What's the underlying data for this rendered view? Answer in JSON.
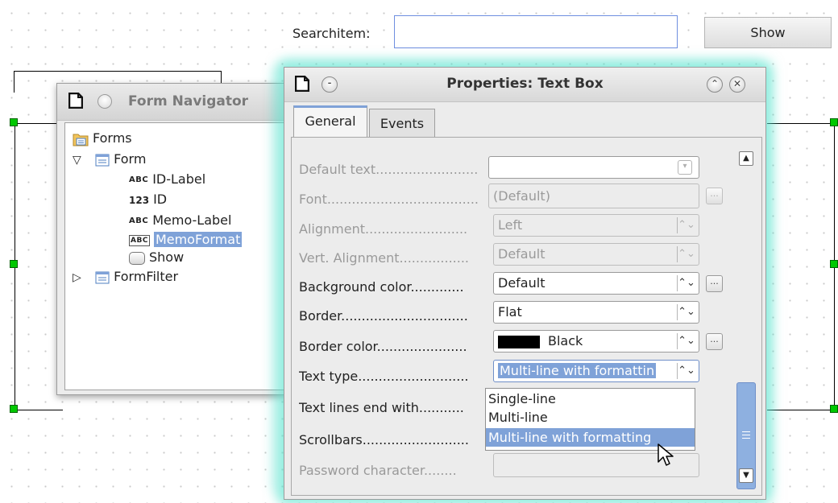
{
  "search": {
    "label": "Searchitem:",
    "value": ""
  },
  "show_button": {
    "label": "Show"
  },
  "navigator": {
    "title": "Form Navigator",
    "tree": [
      {
        "label": "Forms",
        "icon": "forms-folder-icon"
      },
      {
        "label": "Form",
        "icon": "form-icon",
        "expander": "▽"
      },
      {
        "label": "ID-Label",
        "badge": "ABC"
      },
      {
        "label": "ID",
        "badge": "123"
      },
      {
        "label": "Memo-Label",
        "badge": "ABC"
      },
      {
        "label": "MemoFormat",
        "badge": "ABC",
        "selected": true
      },
      {
        "label": "Show",
        "icon": "button-icon"
      },
      {
        "label": "FormFilter",
        "icon": "form-icon",
        "expander": "▷"
      }
    ]
  },
  "properties": {
    "title": "Properties: Text Box",
    "tabs": [
      "General",
      "Events"
    ],
    "rows": [
      {
        "label": "Default text.........................",
        "value": "",
        "disabled": true
      },
      {
        "label": "Font.....................................",
        "value": "(Default)",
        "disabled": true
      },
      {
        "label": "Alignment.........................",
        "value": "Left",
        "disabled": true
      },
      {
        "label": "Vert. Alignment.................",
        "value": "Default",
        "disabled": true
      },
      {
        "label": "Background color.............",
        "value": "Default",
        "disabled": false
      },
      {
        "label": "Border...............................",
        "value": "Flat",
        "disabled": false
      },
      {
        "label": "Border color......................",
        "value": "Black",
        "disabled": false
      },
      {
        "label": "Text type...........................",
        "value": "Multi-line with formattin",
        "disabled": false
      },
      {
        "label": "Text lines end with...........",
        "value": "",
        "disabled": false
      },
      {
        "label": "Scrollbars..........................",
        "value": "",
        "disabled": false
      },
      {
        "label": "Password character........",
        "value": "",
        "disabled": true
      }
    ],
    "dropdown_options": [
      "Single-line",
      "Multi-line",
      "Multi-line with formatting"
    ],
    "highlighted_option": "Multi-line with formatting"
  },
  "colors": {
    "accent": "#7fa2d8",
    "handle": "#00c800",
    "glow": "#46dcc8"
  }
}
